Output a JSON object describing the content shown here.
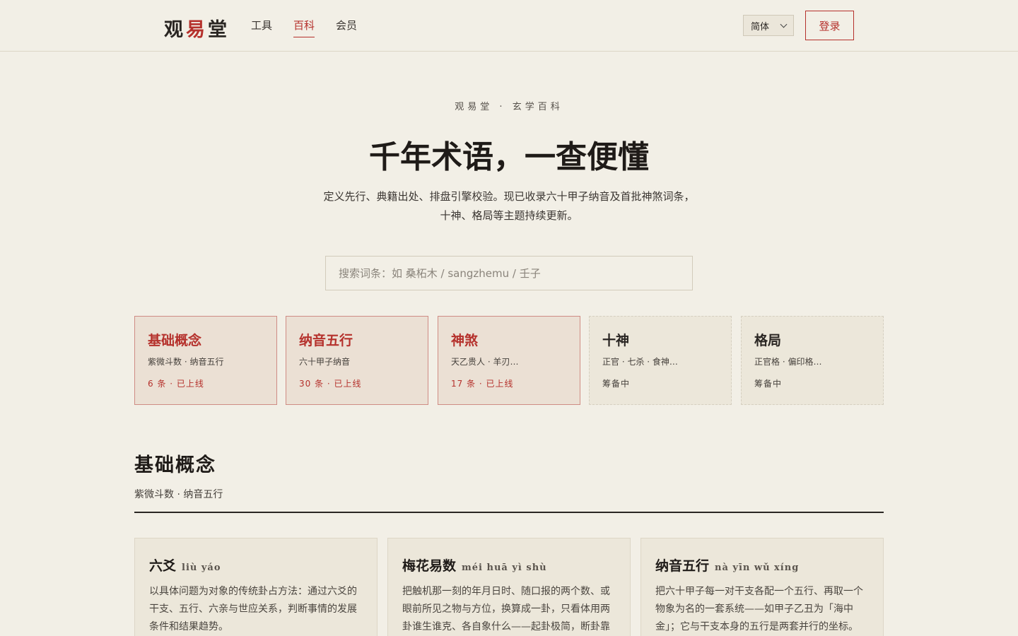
{
  "header": {
    "logo": {
      "part1": "观",
      "part2": "易",
      "part3": "堂"
    },
    "nav": [
      {
        "label": "工具"
      },
      {
        "label": "百科"
      },
      {
        "label": "会员"
      }
    ],
    "language": "简体",
    "login_label": "登录"
  },
  "hero": {
    "eyebrow": "观易堂 · 玄学百科",
    "title": "千年术语，一查便懂",
    "desc_line1": "定义先行、典籍出处、排盘引擎校验。现已收录六十甲子纳音及首批神煞词条，",
    "desc_line2": "十神、格局等主题持续更新。",
    "search_placeholder": "搜索词条：如 桑柘木 / sangzhemu / 壬子"
  },
  "categories": [
    {
      "title": "基础概念",
      "sub": "紫微斗数 · 纳音五行",
      "status": "6 条 · 已上线"
    },
    {
      "title": "纳音五行",
      "sub": "六十甲子纳音",
      "status": "30 条 · 已上线"
    },
    {
      "title": "神煞",
      "sub": "天乙贵人 · 羊刃…",
      "status": "17 条 · 已上线"
    },
    {
      "title": "十神",
      "sub": "正官 · 七杀 · 食神…",
      "status": "筹备中"
    },
    {
      "title": "格局",
      "sub": "正官格 · 偏印格…",
      "status": "筹备中"
    }
  ],
  "section": {
    "title": "基础概念",
    "sub": "紫微斗数 · 纳音五行"
  },
  "entries": [
    {
      "term": "六爻",
      "pinyin": "liù yáo",
      "desc": "以具体问题为对象的传统卦占方法：通过六爻的干支、五行、六亲与世应关系，判断事情的发展条件和结果趋势。"
    },
    {
      "term": "梅花易数",
      "pinyin": "méi huā yì shù",
      "desc": "把触机那一刻的年月日时、随口报的两个数、或眼前所见之物与方位，换算成一卦，只看体用两卦谁生谁克、各自象什么——起卦极简，断卦靠象。"
    },
    {
      "term": "纳音五行",
      "pinyin": "nà yīn wǔ xíng",
      "desc": "把六十甲子每一对干支各配一个五行、再取一个物象为名的一套系统——如甲子乙丑为「海中金」；它与干支本身的五行是两套并行的坐标。"
    }
  ]
}
